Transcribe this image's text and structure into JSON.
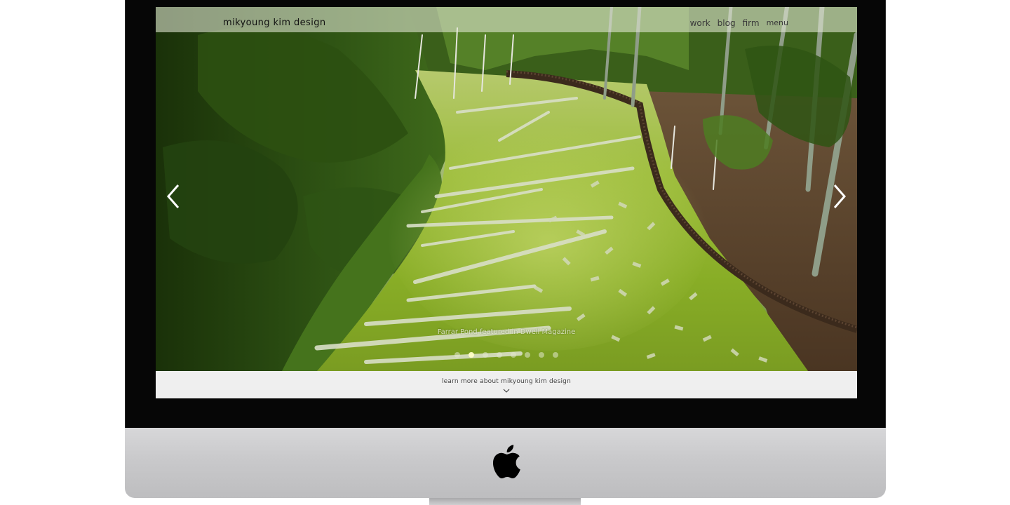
{
  "site": {
    "logo": "mikyoung kim design",
    "nav": [
      {
        "label": "work"
      },
      {
        "label": "blog"
      },
      {
        "label": "firm"
      },
      {
        "label": "menu"
      }
    ]
  },
  "slideshow": {
    "caption": "Farrar Pond featured in Dwell Magazine",
    "slide_count": 8,
    "active_index": 1,
    "prev_icon": "chevron-left-icon",
    "next_icon": "chevron-right-icon"
  },
  "footer": {
    "learn_more": "learn more about mikyoung kim design",
    "chevron_icon": "chevron-down-icon"
  },
  "device": {
    "brand_icon": "apple-logo-icon"
  },
  "colors": {
    "bezel": "#060606",
    "chin": "#c9c9cb",
    "header_bg": "#e6ead7",
    "learn_bar_bg": "#efefef",
    "moss_green": "#8fb52a",
    "forest_green": "#2b4a12"
  }
}
